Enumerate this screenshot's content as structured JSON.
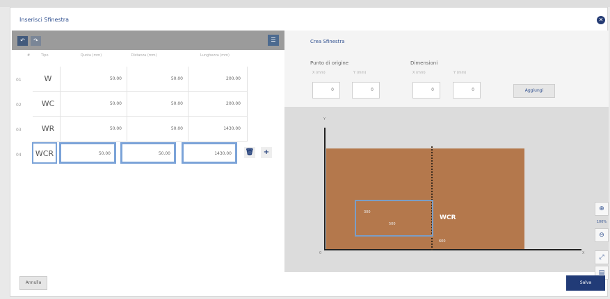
{
  "dialog": {
    "title": "Inserisci Sfinestra",
    "close_icon": "close-icon"
  },
  "toolbar": {
    "undo_icon": "undo-icon",
    "redo_icon": "redo-icon",
    "list_icon": "list-icon"
  },
  "table": {
    "headers": {
      "num": "#",
      "tipo": "Tipo",
      "quota": "Quota (mm)",
      "distanza": "Distanza (mm)",
      "lunghezza": "Lunghezza (mm)"
    },
    "rows": [
      {
        "num": "01",
        "tipo": "W",
        "quota": "50.00",
        "distanza": "50.00",
        "lunghezza": "200.00"
      },
      {
        "num": "02",
        "tipo": "WC",
        "quota": "50.00",
        "distanza": "50.00",
        "lunghezza": "200.00"
      },
      {
        "num": "03",
        "tipo": "WR",
        "quota": "50.00",
        "distanza": "50.00",
        "lunghezza": "1430.00"
      },
      {
        "num": "04",
        "tipo": "WCR",
        "quota": "50.00",
        "distanza": "50.00",
        "lunghezza": "1430.00"
      }
    ]
  },
  "right": {
    "title": "Crea Sfinestra",
    "origin_label": "Punto di origine",
    "dims_label": "Dimensioni",
    "x_label": "X (mm)",
    "y_label": "Y (mm)",
    "origin_x": "0",
    "origin_y": "0",
    "dim_x": "0",
    "dim_y": "0",
    "add_label": "Aggiungi"
  },
  "canvas": {
    "axis_y": "Y",
    "axis_x": "X",
    "origin": "0",
    "win_h": "300",
    "win_w": "500",
    "tag": "WCR",
    "pos": "600",
    "zoom": "100%"
  },
  "footer": {
    "cancel": "Annulla",
    "save": "Salva"
  }
}
